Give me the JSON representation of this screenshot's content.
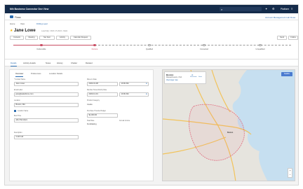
{
  "topbar": {
    "title": "Nth Business Connector Dev View",
    "user": "Platform"
  },
  "nav": {
    "app": "Flows",
    "right_link": "Account Management Lab Dosa"
  },
  "subnav": [
    "Home",
    "View",
    "Drilling Lead"
  ],
  "header": {
    "name": "Jane Lowe",
    "subtitle": "Lead Mgr: 2024 2.5.2024 • Mark",
    "buttons": [
      "Contacts",
      "Meeting",
      "Net Next",
      "Activity",
      "Calendar Request"
    ],
    "right_buttons": [
      "Send",
      "Follow"
    ]
  },
  "stages": {
    "labels": [
      "Deliverable",
      "Nurture",
      "Qualified",
      "Converted",
      "Unqualified"
    ],
    "current_index": 1
  },
  "tabs": [
    "Details",
    "Activity details",
    "Notes",
    "History",
    "Chatter",
    "Related"
  ],
  "form": {
    "subtabs": [
      "Overview",
      "Preferences",
      "Location Details"
    ],
    "labels": {
      "contact_name": "* Contact Name",
      "email": "Email Label",
      "location": "Location",
      "best_time": "Best Time",
      "move_in": "Move-In Date",
      "member_since": "Member Since/Activity Date",
      "product_category": "Product Category",
      "budget": "Purchase Timeline Budget",
      "heat": "Heat Rate",
      "annual": "Annual Income",
      "description": "Description",
      "same_as_shipping": "Location Same"
    },
    "values": {
      "contact_name": "Jane Lowe",
      "email": "jane@salesforce.com",
      "location": "Boston, MA",
      "best_time": "after 8am/4pm",
      "move_in": "2024-01-08",
      "move_in_time": "10:30 AM",
      "member_since": "2023-12-01",
      "member_since_time": "10:30 AM",
      "product_category": "Condo",
      "budget": "$1,000.00",
      "heat": "Fundraising",
      "description": "Cold Call"
    }
  },
  "map": {
    "card_title": "Boston",
    "card_subtitle": "Massachusetts, USA",
    "directions": "Directions",
    "save": "Save",
    "larger_map": "View larger map",
    "button": "Satellite",
    "city_label": "Boston",
    "water_color": "#c6dff0",
    "land_color": "#e6e4de",
    "road_color": "#f2c35b",
    "boundary_color": "#e06a7d"
  },
  "colors": {
    "accent": "#2b6cb0",
    "brand": "#142b4a",
    "stage": "#c94d63"
  }
}
